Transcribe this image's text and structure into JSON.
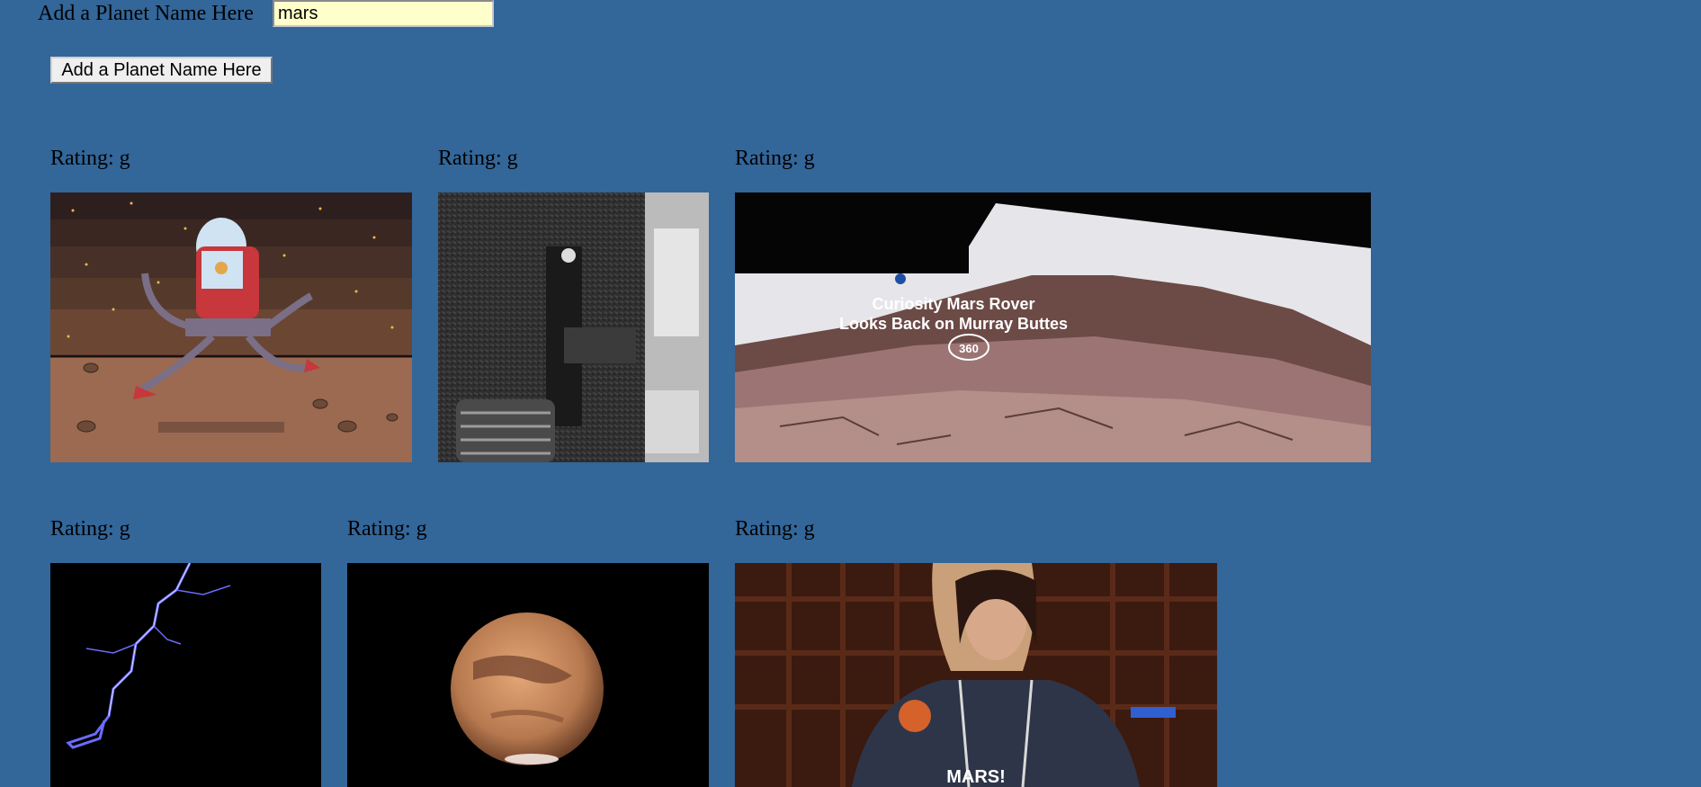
{
  "search": {
    "label": "Add a Planet Name Here",
    "value": "mars"
  },
  "add_button_label": "Add a Planet Name Here",
  "results": [
    {
      "rating": "Rating: g",
      "content": "cartoon robot running on mars"
    },
    {
      "rating": "Rating: g",
      "content": "curiosity rover wheel on gravel"
    },
    {
      "rating": "Rating: g",
      "content": "Curiosity Mars Rover panorama",
      "overlay_title": "Curiosity Mars Rover",
      "overlay_subtitle": "Looks Back on Murray Buttes",
      "overlay_badge": "360"
    },
    {
      "rating": "Rating: g",
      "content": "lightning bolt on black"
    },
    {
      "rating": "Rating: g",
      "content": "planet mars on black"
    },
    {
      "rating": "Rating: g",
      "content": "astronaut woman shouting MARS",
      "overlay_caption": "MARS!"
    }
  ]
}
